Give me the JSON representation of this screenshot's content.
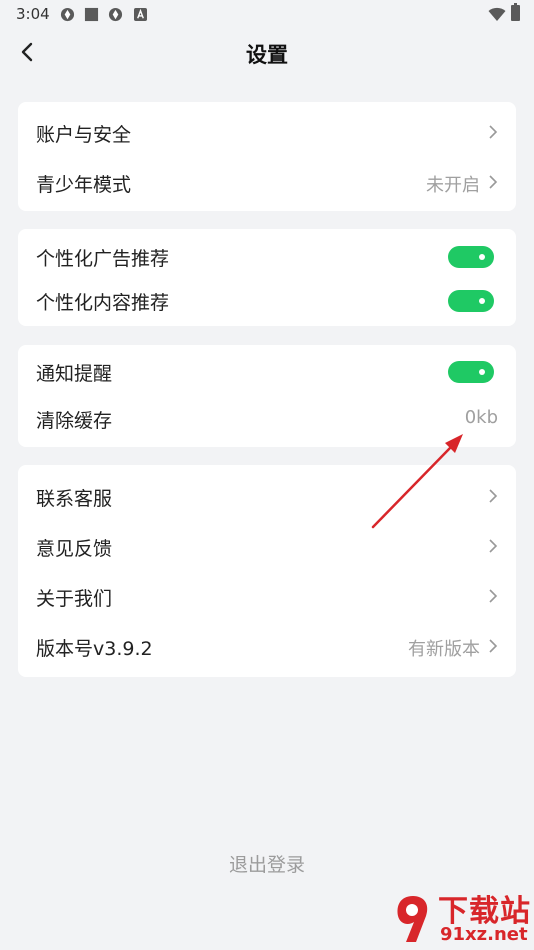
{
  "status_bar": {
    "time": "3:04"
  },
  "header": {
    "title": "设置"
  },
  "card_account": {
    "account_security": "账户与安全",
    "youth_mode": "青少年模式",
    "youth_mode_value": "未开启"
  },
  "card_recommend": {
    "personalized_ads": "个性化广告推荐",
    "personalized_ads_on": true,
    "personalized_content": "个性化内容推荐",
    "personalized_content_on": true
  },
  "card_notify": {
    "notification": "通知提醒",
    "notification_on": true,
    "clear_cache": "清除缓存",
    "cache_size": "0kb"
  },
  "card_about": {
    "contact_service": "联系客服",
    "feedback": "意见反馈",
    "about_us": "关于我们",
    "version": "版本号v3.9.2",
    "version_value": "有新版本"
  },
  "logout": "退出登录",
  "watermark": {
    "line1": "下载站",
    "line2": "91xz.net"
  },
  "colors": {
    "toggle_on": "#1fc964",
    "annotation_arrow": "#d8262a"
  }
}
